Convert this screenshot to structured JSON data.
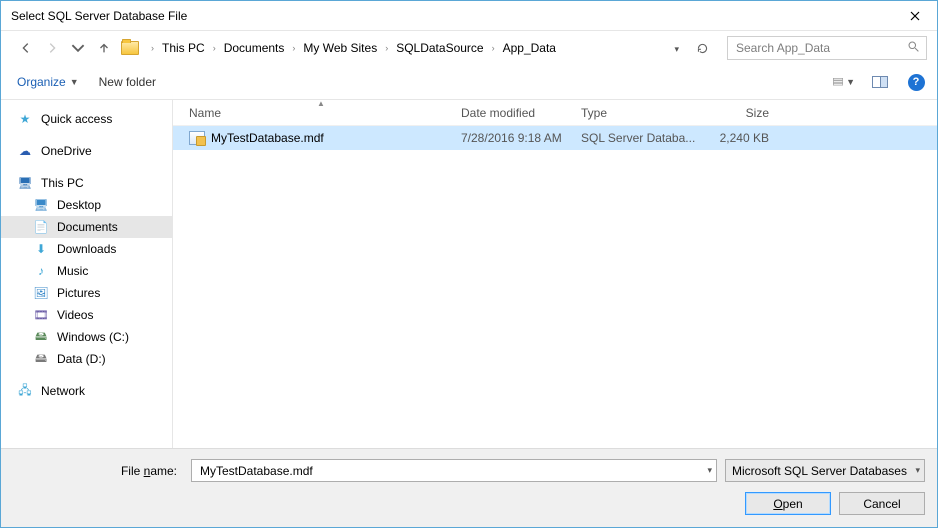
{
  "window": {
    "title": "Select SQL Server Database File"
  },
  "breadcrumb": [
    "This PC",
    "Documents",
    "My Web Sites",
    "SQLDataSource",
    "App_Data"
  ],
  "search": {
    "placeholder": "Search App_Data"
  },
  "toolbar": {
    "organize": "Organize",
    "new_folder": "New folder"
  },
  "columns": {
    "name": "Name",
    "date": "Date modified",
    "type": "Type",
    "size": "Size"
  },
  "files": [
    {
      "name": "MyTestDatabase.mdf",
      "date": "7/28/2016 9:18 AM",
      "type": "SQL Server Databa...",
      "size": "2,240 KB",
      "selected": true
    }
  ],
  "sidebar": {
    "quick_access": "Quick access",
    "onedrive": "OneDrive",
    "this_pc": "This PC",
    "desktop": "Desktop",
    "documents": "Documents",
    "downloads": "Downloads",
    "music": "Music",
    "pictures": "Pictures",
    "videos": "Videos",
    "windows_c": "Windows (C:)",
    "data_d": "Data (D:)",
    "network": "Network"
  },
  "footer": {
    "filename_label_pre": "File ",
    "filename_label_u": "n",
    "filename_label_post": "ame:",
    "filename_value": "MyTestDatabase.mdf",
    "filter": "Microsoft SQL Server Databases",
    "open_u": "O",
    "open_post": "pen",
    "cancel": "Cancel"
  }
}
